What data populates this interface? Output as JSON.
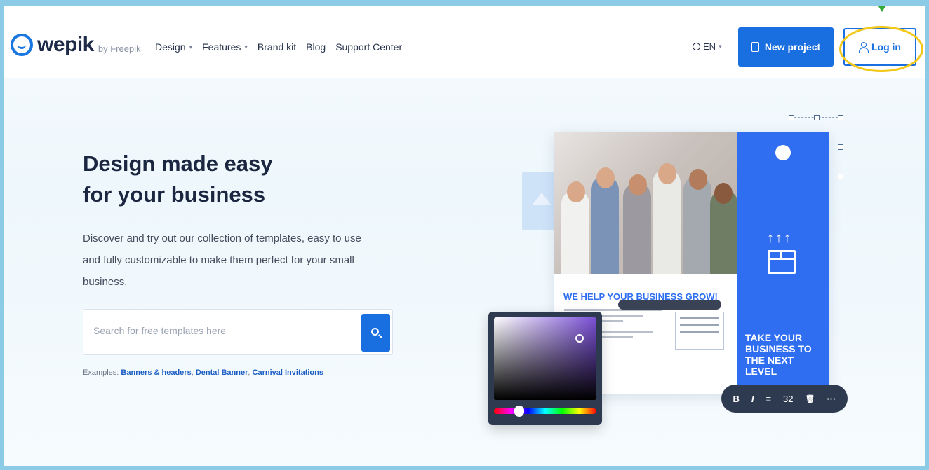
{
  "brand": {
    "name": "wepik",
    "by": "by Freepik"
  },
  "nav": {
    "items": [
      {
        "label": "Design",
        "has_dropdown": true
      },
      {
        "label": "Features",
        "has_dropdown": true
      },
      {
        "label": "Brand kit",
        "has_dropdown": false
      },
      {
        "label": "Blog",
        "has_dropdown": false
      },
      {
        "label": "Support Center",
        "has_dropdown": false
      }
    ],
    "language": "EN",
    "new_project_label": "New project",
    "login_label": "Log in"
  },
  "hero": {
    "title_line1": "Design made easy",
    "title_line2": "for your business",
    "description": "Discover and try out our collection of templates, easy to use and fully customizable to make them perfect for your small business."
  },
  "search": {
    "placeholder": "Search for free templates here",
    "value": "",
    "examples_prefix": "Examples:",
    "examples": [
      "Banners & headers",
      "Dental Banner",
      "Carnival Invitations"
    ]
  },
  "illustration": {
    "card_heading": "WE HELP YOUR BUSINESS GROW!",
    "panel_text": "TAKE YOUR BUSINESS TO THE NEXT LEVEL",
    "panel_arrows": "↑↑↑",
    "text_toolbar": {
      "bold": "B",
      "italic": "I",
      "align": "≡",
      "size": "32",
      "delete": "🗑",
      "more": "···"
    }
  },
  "colors": {
    "accent": "#1a6fe0",
    "panel": "#2f6ef1",
    "dark": "#2e3a4f",
    "highlight": "#f3c81a",
    "frame": "#8ccbe6"
  },
  "icons": {
    "logo": "wepik-logo-icon",
    "globe": "globe-icon",
    "new_project": "document-icon",
    "login": "user-icon",
    "search": "search-icon",
    "chevron": "chevron-down-icon"
  }
}
